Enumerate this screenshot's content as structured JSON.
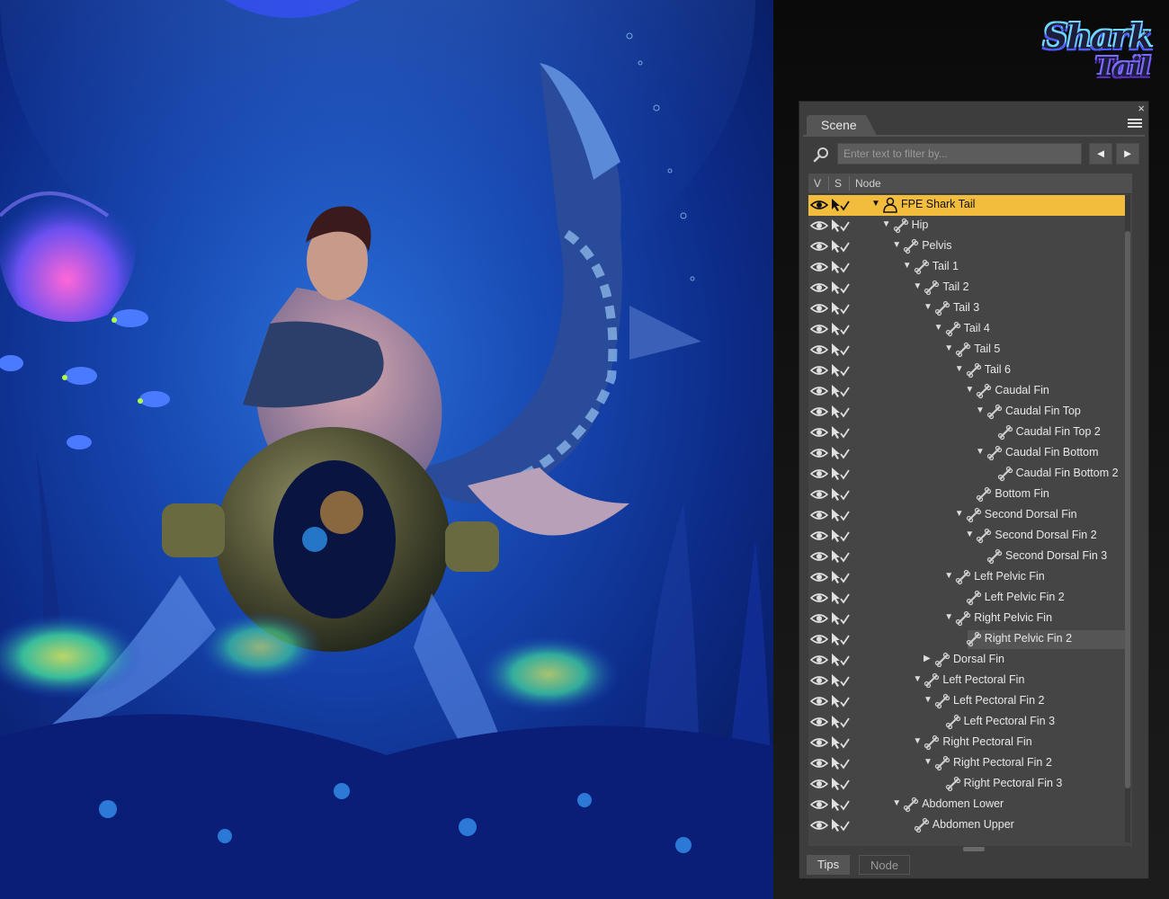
{
  "logo": {
    "line1": "Shark",
    "line2": "Tail"
  },
  "scene_pane": {
    "tab": "Scene",
    "close_glyph": "×",
    "filter": {
      "placeholder": "Enter text to filter by...",
      "value": ""
    },
    "nav": {
      "prev": "◄",
      "next": "►"
    },
    "columns": {
      "v": "V",
      "s": "S",
      "node": "Node"
    },
    "nodes": [
      {
        "label": "FPE Shark Tail",
        "depth": 0,
        "expander": "open",
        "icon": "figure-icon",
        "selected": true
      },
      {
        "label": "Hip",
        "depth": 1,
        "expander": "open",
        "icon": "bone-icon"
      },
      {
        "label": "Pelvis",
        "depth": 2,
        "expander": "open",
        "icon": "bone-icon"
      },
      {
        "label": "Tail 1",
        "depth": 3,
        "expander": "open",
        "icon": "bone-icon"
      },
      {
        "label": "Tail 2",
        "depth": 4,
        "expander": "open",
        "icon": "bone-icon"
      },
      {
        "label": "Tail 3",
        "depth": 5,
        "expander": "open",
        "icon": "bone-icon"
      },
      {
        "label": "Tail 4",
        "depth": 6,
        "expander": "open",
        "icon": "bone-icon"
      },
      {
        "label": "Tail 5",
        "depth": 7,
        "expander": "open",
        "icon": "bone-icon"
      },
      {
        "label": "Tail 6",
        "depth": 8,
        "expander": "open",
        "icon": "bone-icon"
      },
      {
        "label": "Caudal Fin",
        "depth": 9,
        "expander": "open",
        "icon": "bone-icon"
      },
      {
        "label": "Caudal Fin Top",
        "depth": 10,
        "expander": "open",
        "icon": "bone-icon"
      },
      {
        "label": "Caudal Fin Top 2",
        "depth": 11,
        "expander": "none",
        "icon": "bone-icon"
      },
      {
        "label": "Caudal Fin Bottom",
        "depth": 10,
        "expander": "open",
        "icon": "bone-icon"
      },
      {
        "label": "Caudal Fin Bottom 2",
        "depth": 11,
        "expander": "none",
        "icon": "bone-icon"
      },
      {
        "label": "Bottom Fin",
        "depth": 9,
        "expander": "none",
        "icon": "bone-icon"
      },
      {
        "label": "Second Dorsal Fin",
        "depth": 8,
        "expander": "open",
        "icon": "bone-icon"
      },
      {
        "label": "Second Dorsal Fin 2",
        "depth": 9,
        "expander": "open",
        "icon": "bone-icon"
      },
      {
        "label": "Second Dorsal Fin 3",
        "depth": 10,
        "expander": "none",
        "icon": "bone-icon"
      },
      {
        "label": "Left Pelvic Fin",
        "depth": 7,
        "expander": "open",
        "icon": "bone-icon"
      },
      {
        "label": "Left Pelvic Fin 2",
        "depth": 8,
        "expander": "none",
        "icon": "bone-icon"
      },
      {
        "label": "Right Pelvic Fin",
        "depth": 7,
        "expander": "open",
        "icon": "bone-icon"
      },
      {
        "label": "Right Pelvic Fin 2",
        "depth": 8,
        "expander": "none",
        "icon": "bone-icon",
        "hover": true
      },
      {
        "label": "Dorsal Fin",
        "depth": 5,
        "expander": "closed",
        "icon": "bone-icon"
      },
      {
        "label": "Left Pectoral Fin",
        "depth": 4,
        "expander": "open",
        "icon": "bone-icon"
      },
      {
        "label": "Left Pectoral Fin 2",
        "depth": 5,
        "expander": "open",
        "icon": "bone-icon"
      },
      {
        "label": "Left Pectoral Fin 3",
        "depth": 6,
        "expander": "none",
        "icon": "bone-icon"
      },
      {
        "label": "Right Pectoral Fin",
        "depth": 4,
        "expander": "open",
        "icon": "bone-icon"
      },
      {
        "label": "Right Pectoral Fin 2",
        "depth": 5,
        "expander": "open",
        "icon": "bone-icon"
      },
      {
        "label": "Right Pectoral Fin 3",
        "depth": 6,
        "expander": "none",
        "icon": "bone-icon"
      },
      {
        "label": "Abdomen Lower",
        "depth": 2,
        "expander": "open",
        "icon": "bone-icon"
      },
      {
        "label": "Abdomen Upper",
        "depth": 3,
        "expander": "none",
        "icon": "bone-icon"
      }
    ],
    "bottom_tabs": {
      "tips": "Tips",
      "node": "Node"
    }
  },
  "colors": {
    "selected_row": "#f2bd3c",
    "panel_bg": "#3d3d3d",
    "tree_bg": "#454545"
  }
}
